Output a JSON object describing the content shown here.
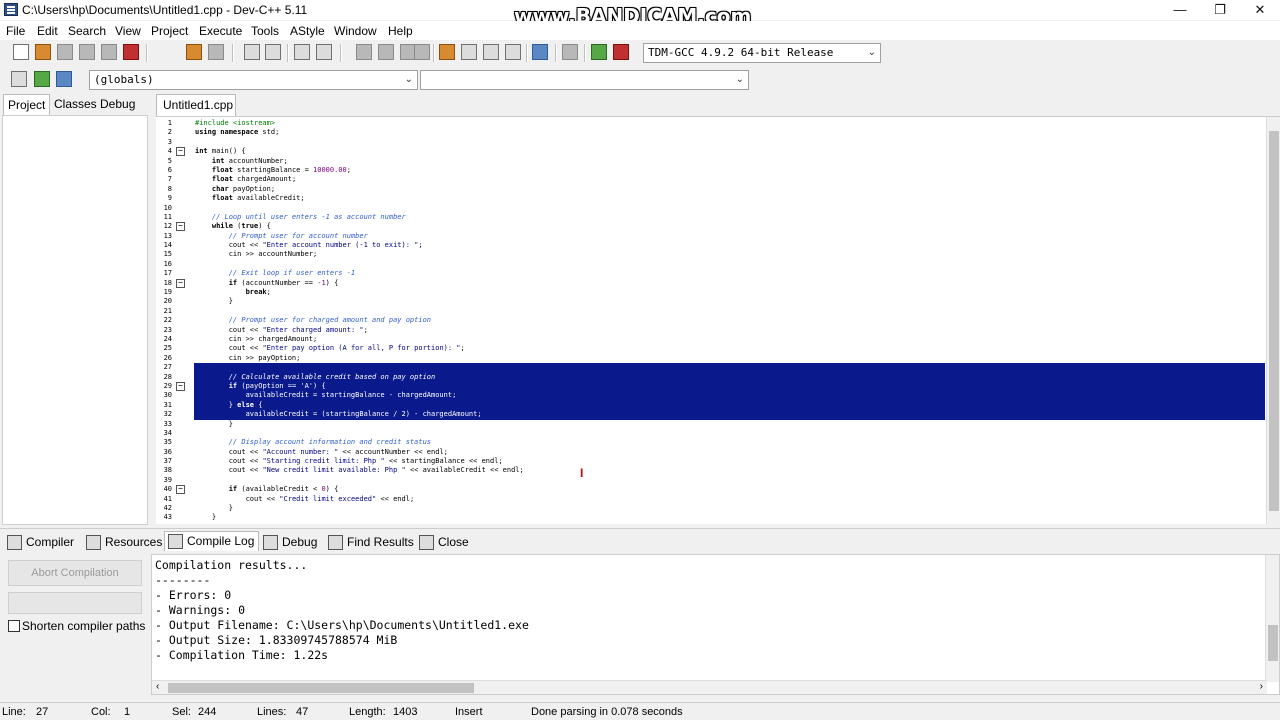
{
  "window": {
    "title": "C:\\Users\\hp\\Documents\\Untitled1.cpp - Dev-C++ 5.11",
    "watermark": "www.BANDICAM.com",
    "minimize": "—",
    "maximize": "❐",
    "close": "✕"
  },
  "menu": [
    "File",
    "Edit",
    "Search",
    "View",
    "Project",
    "Execute",
    "Tools",
    "AStyle",
    "Window",
    "Help"
  ],
  "toolbar": {
    "compiler_select": "TDM-GCC 4.9.2 64-bit Release",
    "globals_select": "(globals)",
    "second_select": ""
  },
  "left_tabs": [
    "Project",
    "Classes",
    "Debug"
  ],
  "editor_tab": "Untitled1.cpp",
  "code": [
    {
      "n": "1",
      "fold": "",
      "html": "<span class='pp'>#include &lt;iostream&gt;</span>"
    },
    {
      "n": "2",
      "fold": "",
      "html": "<span class='kw'>using namespace</span> std;"
    },
    {
      "n": "3",
      "fold": "",
      "html": ""
    },
    {
      "n": "4",
      "fold": "−",
      "html": "<span class='kw'>int</span> main() {"
    },
    {
      "n": "5",
      "fold": "",
      "html": "    <span class='kw'>int</span> accountNumber;"
    },
    {
      "n": "6",
      "fold": "",
      "html": "    <span class='kw'>float</span> startingBalance = <span class='num'>10000.00</span>;"
    },
    {
      "n": "7",
      "fold": "",
      "html": "    <span class='kw'>float</span> chargedAmount;"
    },
    {
      "n": "8",
      "fold": "",
      "html": "    <span class='kw'>char</span> payOption;"
    },
    {
      "n": "9",
      "fold": "",
      "html": "    <span class='kw'>float</span> availableCredit;"
    },
    {
      "n": "10",
      "fold": "",
      "html": ""
    },
    {
      "n": "11",
      "fold": "",
      "html": "    <span class='cm'>// Loop until user enters -1 as account number</span>"
    },
    {
      "n": "12",
      "fold": "−",
      "html": "    <span class='kw'>while</span> (<span class='kw'>true</span>) {"
    },
    {
      "n": "13",
      "fold": "",
      "html": "        <span class='cm'>// Prompt user for account number</span>"
    },
    {
      "n": "14",
      "fold": "",
      "html": "        cout &lt;&lt; <span class='str'>\"Enter account number (-1 to exit): \"</span>;"
    },
    {
      "n": "15",
      "fold": "",
      "html": "        cin &gt;&gt; accountNumber;"
    },
    {
      "n": "16",
      "fold": "",
      "html": ""
    },
    {
      "n": "17",
      "fold": "",
      "html": "        <span class='cm'>// Exit loop if user enters -1</span>"
    },
    {
      "n": "18",
      "fold": "−",
      "html": "        <span class='kw'>if</span> (accountNumber == <span class='num'>-1</span>) {"
    },
    {
      "n": "19",
      "fold": "",
      "html": "            <span class='kw'>break</span>;"
    },
    {
      "n": "20",
      "fold": "",
      "html": "        }"
    },
    {
      "n": "21",
      "fold": "",
      "html": ""
    },
    {
      "n": "22",
      "fold": "",
      "html": "        <span class='cm'>// Prompt user for charged amount and pay option</span>"
    },
    {
      "n": "23",
      "fold": "",
      "html": "        cout &lt;&lt; <span class='str'>\"Enter charged amount: \"</span>;"
    },
    {
      "n": "24",
      "fold": "",
      "html": "        cin &gt;&gt; chargedAmount;"
    },
    {
      "n": "25",
      "fold": "",
      "html": "        cout &lt;&lt; <span class='str'>\"Enter pay option (A for all, P for portion): \"</span>;"
    },
    {
      "n": "26",
      "fold": "",
      "html": "        cin &gt;&gt; payOption;"
    },
    {
      "n": "27",
      "fold": "",
      "sel": true,
      "html": ""
    },
    {
      "n": "28",
      "fold": "",
      "sel": true,
      "html": "        <i>// Calculate available credit based on pay option</i>"
    },
    {
      "n": "29",
      "fold": "−",
      "sel": true,
      "html": "        <b>if</b> (payOption == 'A') {"
    },
    {
      "n": "30",
      "fold": "",
      "sel": true,
      "html": "            availableCredit = startingBalance - chargedAmount;"
    },
    {
      "n": "31",
      "fold": "",
      "sel": true,
      "html": "        } <b>else</b> {"
    },
    {
      "n": "32",
      "fold": "",
      "sel": true,
      "html": "            availableCredit = (startingBalance / 2) - chargedAmount;"
    },
    {
      "n": "33",
      "fold": "",
      "html": "        }"
    },
    {
      "n": "34",
      "fold": "",
      "html": ""
    },
    {
      "n": "35",
      "fold": "",
      "html": "        <span class='cm'>// Display account information and credit status</span>"
    },
    {
      "n": "36",
      "fold": "",
      "html": "        cout &lt;&lt; <span class='str'>\"Account number: \"</span> &lt;&lt; accountNumber &lt;&lt; endl;"
    },
    {
      "n": "37",
      "fold": "",
      "html": "        cout &lt;&lt; <span class='str'>\"Starting credit limit: Php \"</span> &lt;&lt; startingBalance &lt;&lt; endl;"
    },
    {
      "n": "38",
      "fold": "",
      "html": "        cout &lt;&lt; <span class='str'>\"New credit limit available: Php \"</span> &lt;&lt; availableCredit &lt;&lt; endl;"
    },
    {
      "n": "39",
      "fold": "",
      "html": ""
    },
    {
      "n": "40",
      "fold": "−",
      "html": "        <span class='kw'>if</span> (availableCredit &lt; <span class='num'>0</span>) {"
    },
    {
      "n": "41",
      "fold": "",
      "html": "            cout &lt;&lt; <span class='str'>\"Credit limit exceeded\"</span> &lt;&lt; endl;"
    },
    {
      "n": "42",
      "fold": "",
      "html": "        }"
    },
    {
      "n": "43",
      "fold": "",
      "html": "    }"
    }
  ],
  "bottom_tabs": [
    "Compiler",
    "Resources",
    "Compile Log",
    "Debug",
    "Find Results",
    "Close"
  ],
  "left_bottom": {
    "abort_label": "Abort Compilation",
    "shorten_label": "Shorten compiler paths"
  },
  "log": [
    "Compilation results...",
    "--------",
    "- Errors: 0",
    "- Warnings: 0",
    "- Output Filename: C:\\Users\\hp\\Documents\\Untitled1.exe",
    "- Output Size: 1.83309745788574 MiB",
    "- Compilation Time: 1.22s"
  ],
  "status": {
    "line_label": "Line:",
    "line": "27",
    "col_label": "Col:",
    "col": "1",
    "sel_label": "Sel:",
    "sel": "244",
    "lines_label": "Lines:",
    "lines": "47",
    "length_label": "Length:",
    "length": "1403",
    "mode": "Insert",
    "message": "Done parsing in 0.078 seconds"
  }
}
